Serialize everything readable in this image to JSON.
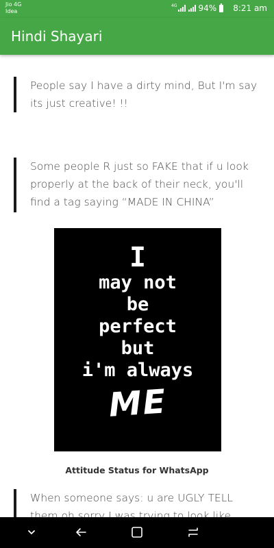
{
  "status_bar": {
    "carrier1": "Jio 4G",
    "carrier2": "Idea",
    "network_tag": "4G",
    "battery": "94%",
    "time": "8:21 am"
  },
  "app_bar": {
    "title": "Hindi Shayari"
  },
  "posts": [
    {
      "text": "People say I have a dirty mind, But I'm say its just creative! !!"
    },
    {
      "text": "Some people R just so FAKE that if u look properly at the back of their neck, you'll find a tag saying “MADE IN CHINA”"
    },
    {
      "text": "When someone says: u are UGLY TELL them oh sorry I was trying to look like you!!"
    }
  ],
  "poster": {
    "line1": "I",
    "line2": "may not",
    "line3": "be",
    "line4": "perfect",
    "line5": "but",
    "line6": "i'm always",
    "line7": "ME",
    "caption": "Attitude Status for WhatsApp"
  },
  "nav_bar": {
    "icons": [
      "chevron-down-icon",
      "back-icon",
      "home-icon",
      "recents-icon"
    ]
  },
  "colors": {
    "accent": "#45a745",
    "nav_bg": "#000000",
    "quote_bar": "#1a1a1a"
  }
}
